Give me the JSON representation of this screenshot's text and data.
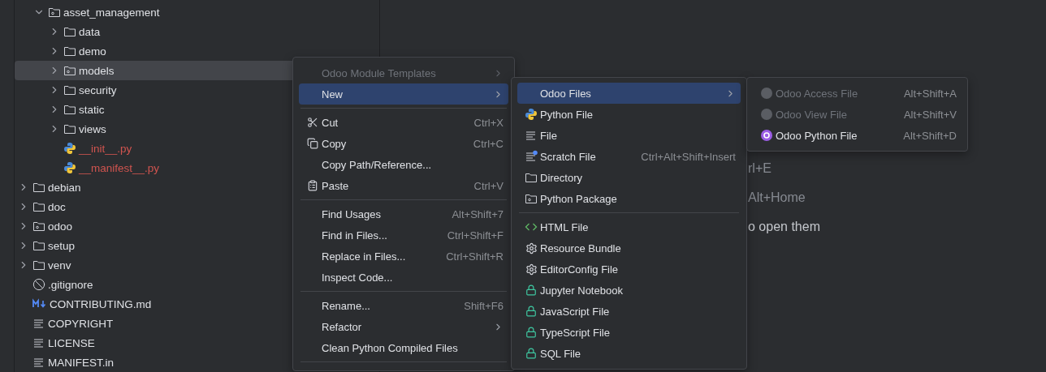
{
  "project_tree": [
    {
      "kind": "hidden-parent",
      "children": [
        {
          "kind": "module",
          "label": "asset_management",
          "expanded": true,
          "selected": false,
          "children": [
            {
              "kind": "folder",
              "label": "data",
              "expanded": false,
              "selected": false
            },
            {
              "kind": "folder",
              "label": "demo",
              "expanded": false,
              "selected": false
            },
            {
              "kind": "module",
              "label": "models",
              "expanded": false,
              "selected": true
            },
            {
              "kind": "folder",
              "label": "security",
              "expanded": false,
              "selected": false
            },
            {
              "kind": "folder",
              "label": "static",
              "expanded": false,
              "selected": false
            },
            {
              "kind": "folder",
              "label": "views",
              "expanded": false,
              "selected": false
            },
            {
              "kind": "python",
              "label": "__init__.py",
              "color": "#d0544f",
              "selected": false
            },
            {
              "kind": "python",
              "label": "__manifest__.py",
              "color": "#d0544f",
              "selected": false
            }
          ]
        }
      ]
    },
    {
      "kind": "folder",
      "label": "debian",
      "expanded": false,
      "selected": false
    },
    {
      "kind": "folder",
      "label": "doc",
      "expanded": false,
      "selected": false
    },
    {
      "kind": "module",
      "label": "odoo",
      "expanded": false,
      "selected": false
    },
    {
      "kind": "folder",
      "label": "setup",
      "expanded": false,
      "selected": false
    },
    {
      "kind": "folder",
      "label": "venv",
      "expanded": false,
      "selected": false
    },
    {
      "kind": "ignore",
      "label": ".gitignore",
      "selected": false
    },
    {
      "kind": "markdown",
      "label": "CONTRIBUTING.md",
      "selected": false
    },
    {
      "kind": "text",
      "label": "COPYRIGHT",
      "selected": false
    },
    {
      "kind": "text",
      "label": "LICENSE",
      "selected": false
    },
    {
      "kind": "text",
      "label": "MANIFEST.in",
      "selected": false
    }
  ],
  "editor_hints": [
    {
      "kind": "shortcut",
      "text": "rl+E"
    },
    {
      "kind": "shortcut",
      "text": "Alt+Home"
    },
    {
      "kind": "text",
      "text": "o open them"
    }
  ],
  "context_menu": [
    {
      "kind": "item",
      "label": "Odoo Module Templates",
      "submenu": true,
      "disabled": true,
      "selected": false
    },
    {
      "kind": "item",
      "label": "New",
      "submenu": true,
      "disabled": false,
      "selected": true
    },
    {
      "kind": "separator"
    },
    {
      "kind": "scissors",
      "label": "Cut",
      "shortcut": "Ctrl+X",
      "disabled": false,
      "selected": false
    },
    {
      "kind": "copy",
      "label": "Copy",
      "shortcut": "Ctrl+C",
      "disabled": false,
      "selected": false
    },
    {
      "kind": "item",
      "label": "Copy Path/Reference...",
      "disabled": false,
      "selected": false
    },
    {
      "kind": "paste",
      "label": "Paste",
      "shortcut": "Ctrl+V",
      "disabled": false,
      "selected": false
    },
    {
      "kind": "separator"
    },
    {
      "kind": "item",
      "label": "Find Usages",
      "shortcut": "Alt+Shift+7",
      "disabled": false,
      "selected": false
    },
    {
      "kind": "item",
      "label": "Find in Files...",
      "shortcut": "Ctrl+Shift+F",
      "disabled": false,
      "selected": false
    },
    {
      "kind": "item",
      "label": "Replace in Files...",
      "shortcut": "Ctrl+Shift+R",
      "disabled": false,
      "selected": false
    },
    {
      "kind": "item",
      "label": "Inspect Code...",
      "disabled": false,
      "selected": false
    },
    {
      "kind": "separator"
    },
    {
      "kind": "item",
      "label": "Rename...",
      "shortcut": "Shift+F6",
      "disabled": false,
      "selected": false
    },
    {
      "kind": "item",
      "label": "Refactor",
      "submenu": true,
      "disabled": false,
      "selected": false
    },
    {
      "kind": "item",
      "label": "Clean Python Compiled Files",
      "disabled": false,
      "selected": false
    },
    {
      "kind": "separator"
    }
  ],
  "new_menu": [
    {
      "kind": "item",
      "label": "Odoo Files",
      "submenu": true,
      "disabled": false,
      "selected": true
    },
    {
      "kind": "python",
      "label": "Python File",
      "disabled": false,
      "selected": false
    },
    {
      "kind": "text",
      "label": "File",
      "disabled": false,
      "selected": false
    },
    {
      "kind": "scratch",
      "label": "Scratch File",
      "shortcut": "Ctrl+Alt+Shift+Insert",
      "disabled": false,
      "selected": false
    },
    {
      "kind": "folder",
      "label": "Directory",
      "disabled": false,
      "selected": false
    },
    {
      "kind": "module",
      "label": "Python Package",
      "disabled": false,
      "selected": false
    },
    {
      "kind": "separator"
    },
    {
      "kind": "html",
      "label": "HTML File",
      "disabled": false,
      "selected": false
    },
    {
      "kind": "gear",
      "label": "Resource Bundle",
      "disabled": false,
      "selected": false
    },
    {
      "kind": "gear",
      "label": "EditorConfig File",
      "disabled": false,
      "selected": false
    },
    {
      "kind": "lock",
      "label": "Jupyter Notebook",
      "disabled": false,
      "selected": false
    },
    {
      "kind": "lock",
      "label": "JavaScript File",
      "disabled": false,
      "selected": false
    },
    {
      "kind": "lock",
      "label": "TypeScript File",
      "disabled": false,
      "selected": false
    },
    {
      "kind": "lock",
      "label": "SQL File",
      "disabled": false,
      "selected": false
    }
  ],
  "odoo_files_menu": [
    {
      "kind": "odoo",
      "label": "Odoo Access File",
      "shortcut": "Alt+Shift+A",
      "disabled": true,
      "selected": false
    },
    {
      "kind": "odoo",
      "label": "Odoo View File",
      "shortcut": "Alt+Shift+V",
      "disabled": true,
      "selected": false
    },
    {
      "kind": "odoo",
      "label": "Odoo Python File",
      "shortcut": "Alt+Shift+D",
      "disabled": false,
      "selected": false
    }
  ]
}
